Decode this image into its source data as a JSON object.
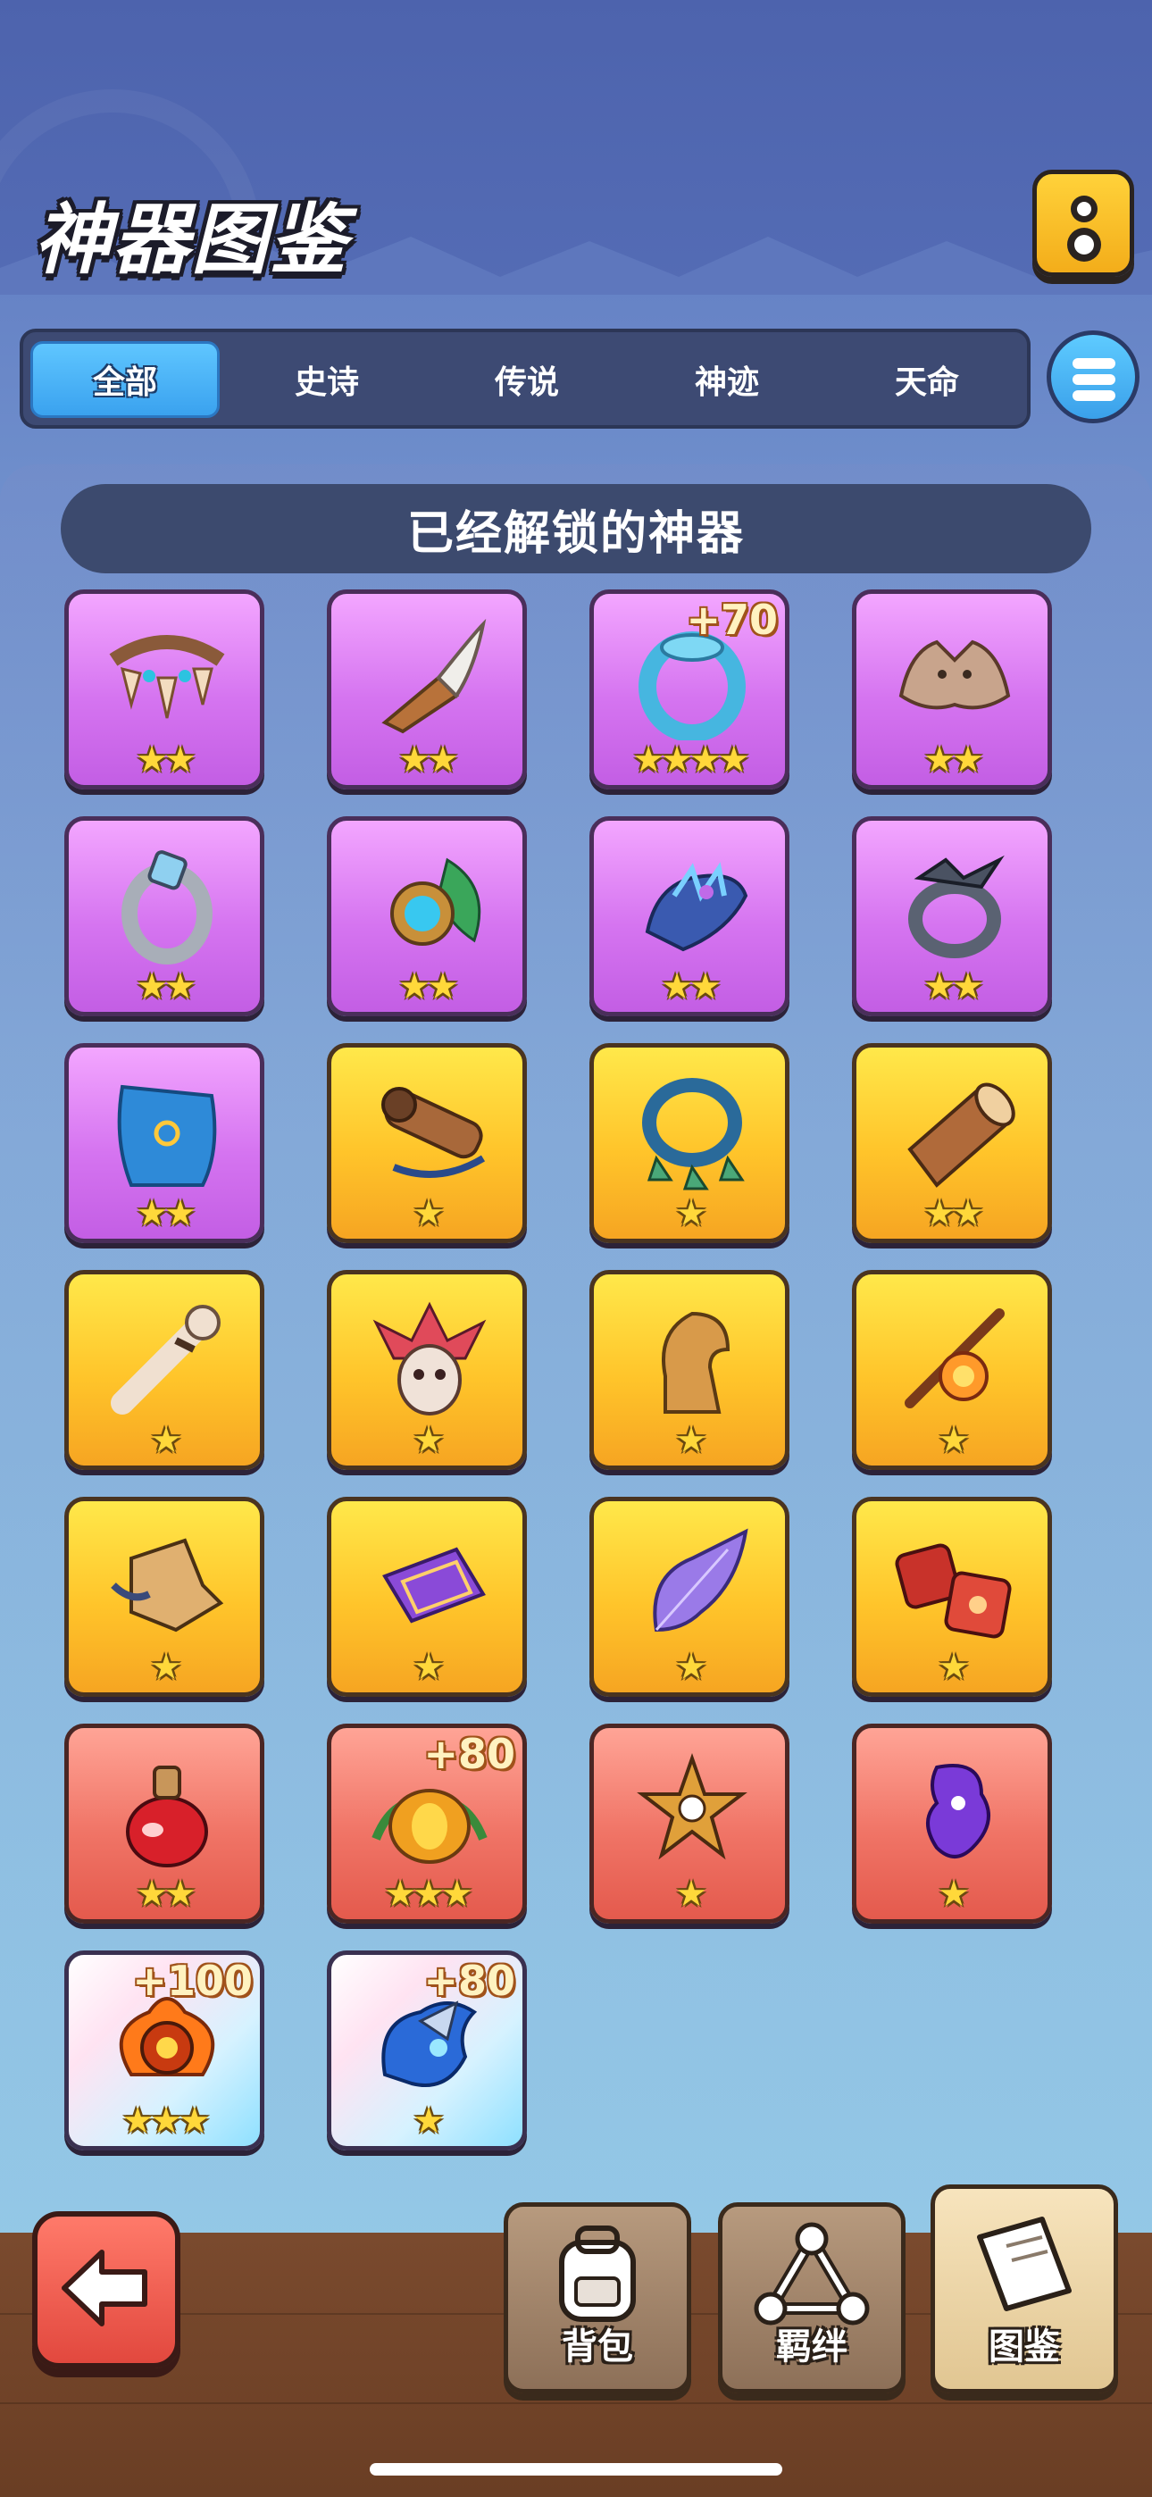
{
  "header": {
    "title": "神器图鉴",
    "info_icon": "exclamation-icon"
  },
  "tabs": [
    {
      "label": "全部",
      "active": true
    },
    {
      "label": "史诗",
      "active": false
    },
    {
      "label": "传说",
      "active": false
    },
    {
      "label": "神迹",
      "active": false
    },
    {
      "label": "天命",
      "active": false
    }
  ],
  "list_button_icon": "list-icon",
  "section": {
    "title": "已经解锁的神器"
  },
  "artifacts": [
    {
      "name": "tooth-necklace",
      "rarity": "purple",
      "stars": "★★",
      "bonus": ""
    },
    {
      "name": "horn-dagger",
      "rarity": "purple",
      "stars": "★★",
      "bonus": ""
    },
    {
      "name": "jade-ring",
      "rarity": "purple",
      "stars": "★★★★",
      "bonus": "+70"
    },
    {
      "name": "wolf-pelt",
      "rarity": "purple",
      "stars": "★★",
      "bonus": ""
    },
    {
      "name": "silver-ring",
      "rarity": "purple",
      "stars": "★★",
      "bonus": ""
    },
    {
      "name": "feather-amulet",
      "rarity": "purple",
      "stars": "★★",
      "bonus": ""
    },
    {
      "name": "crystal-gauntlet",
      "rarity": "purple",
      "stars": "★★",
      "bonus": ""
    },
    {
      "name": "spiked-ring",
      "rarity": "purple",
      "stars": "★★",
      "bonus": ""
    },
    {
      "name": "blue-cape",
      "rarity": "purple",
      "stars": "★★",
      "bonus": ""
    },
    {
      "name": "wooden-cannon",
      "rarity": "gold",
      "stars": "★",
      "bonus": ""
    },
    {
      "name": "bell-necklace",
      "rarity": "gold",
      "stars": "★",
      "bonus": ""
    },
    {
      "name": "war-drum",
      "rarity": "gold",
      "stars": "★★",
      "bonus": ""
    },
    {
      "name": "bone-club",
      "rarity": "gold",
      "stars": "★",
      "bonus": ""
    },
    {
      "name": "tribal-mask",
      "rarity": "gold",
      "stars": "★",
      "bonus": ""
    },
    {
      "name": "knight-piece",
      "rarity": "gold",
      "stars": "★",
      "bonus": ""
    },
    {
      "name": "fire-staff",
      "rarity": "gold",
      "stars": "★",
      "bonus": ""
    },
    {
      "name": "armored-boot",
      "rarity": "gold",
      "stars": "★",
      "bonus": ""
    },
    {
      "name": "magic-carpet",
      "rarity": "gold",
      "stars": "★",
      "bonus": ""
    },
    {
      "name": "violet-leaf",
      "rarity": "gold",
      "stars": "★",
      "bonus": ""
    },
    {
      "name": "red-dice",
      "rarity": "gold",
      "stars": "★",
      "bonus": ""
    },
    {
      "name": "potion-bottle",
      "rarity": "red",
      "stars": "★★",
      "bonus": ""
    },
    {
      "name": "pumpkin-lantern",
      "rarity": "red",
      "stars": "★★★",
      "bonus": "+80"
    },
    {
      "name": "star-mace",
      "rarity": "red",
      "stars": "★",
      "bonus": ""
    },
    {
      "name": "shadow-spirit",
      "rarity": "red",
      "stars": "★",
      "bonus": ""
    },
    {
      "name": "flame-orb",
      "rarity": "holo",
      "stars": "★★★",
      "bonus": "+100"
    },
    {
      "name": "water-dragon",
      "rarity": "holo",
      "stars": "★",
      "bonus": ""
    }
  ],
  "bonus_holo_2": "+80",
  "nav": {
    "back_icon": "arrow-left-icon",
    "bag": {
      "label": "背包",
      "icon": "backpack-icon"
    },
    "bond": {
      "label": "羁绊",
      "icon": "triangle-link-icon"
    },
    "codex": {
      "label": "图鉴",
      "icon": "book-icon",
      "active": true
    }
  },
  "colors": {
    "tab_active": "#3aa2ef",
    "purple_card": "#d574f0",
    "gold_card": "#ffc42a",
    "red_card": "#f07466"
  }
}
